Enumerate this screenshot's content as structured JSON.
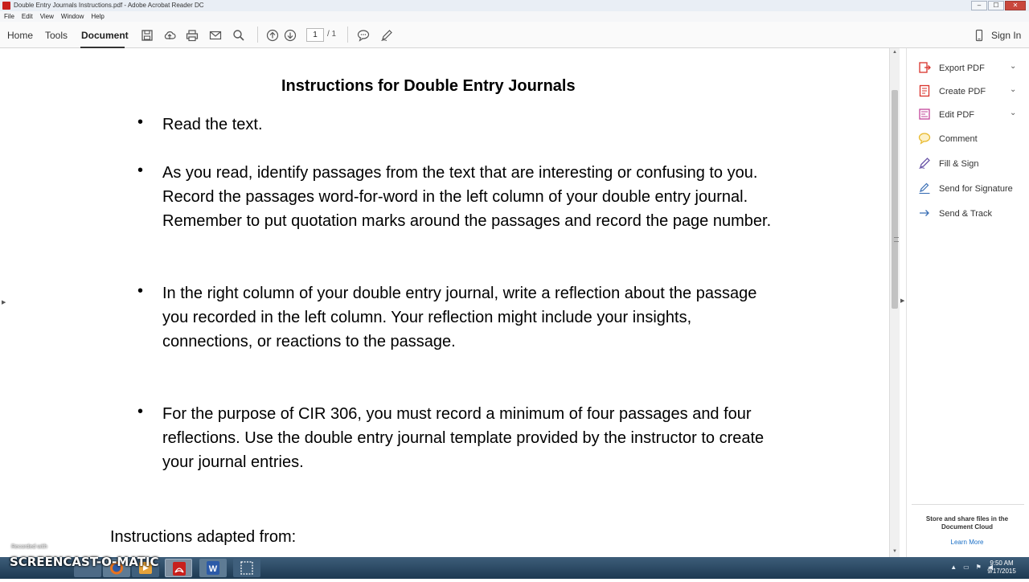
{
  "window": {
    "title": "Double Entry Journals Instructions.pdf - Adobe Acrobat Reader DC",
    "buttons": {
      "minimize": "‒",
      "maximize": "☐",
      "close": "✕"
    }
  },
  "menu": [
    "File",
    "Edit",
    "View",
    "Window",
    "Help"
  ],
  "toolbar": {
    "tabs": [
      {
        "label": "Home"
      },
      {
        "label": "Tools"
      },
      {
        "label": "Document",
        "active": true
      }
    ],
    "icons": [
      "save-icon",
      "upload-cloud-icon",
      "print-icon",
      "email-icon",
      "search-icon",
      "prev-page-icon",
      "next-page-icon",
      "comment-icon",
      "pen-icon"
    ],
    "page_current": "1",
    "page_total": "/ 1",
    "sign_in": "Sign In"
  },
  "document": {
    "title": "Instructions for Double Entry Journals",
    "bullets": [
      "Read the text.",
      "As you read, identify passages from the text that are interesting or confusing to you.  Record the passages word-for-word in the left column of your double entry journal.  Remember to put quotation marks around the passages and record the page number.",
      "In the right column of your double entry journal, write a reflection about the passage you recorded in the left column.  Your reflection might include your insights, connections, or reactions to the passage.",
      "For the purpose of CIR 306, you must record a minimum of four passages and four reflections.  Use the double entry journal template provided by the instructor to create your journal entries."
    ],
    "footer": "Instructions adapted from:"
  },
  "right_pane": {
    "tools": [
      {
        "label": "Export PDF",
        "icon": "export-pdf-icon",
        "color": "#d9322b",
        "expandable": true
      },
      {
        "label": "Create PDF",
        "icon": "create-pdf-icon",
        "color": "#d9322b",
        "expandable": true
      },
      {
        "label": "Edit PDF",
        "icon": "edit-pdf-icon",
        "color": "#c2449a",
        "expandable": true
      },
      {
        "label": "Comment",
        "icon": "comment-icon",
        "color": "#e8b92c",
        "expandable": false
      },
      {
        "label": "Fill & Sign",
        "icon": "fill-sign-icon",
        "color": "#6a55a8",
        "expandable": false
      },
      {
        "label": "Send for Signature",
        "icon": "send-signature-icon",
        "color": "#3a6fb5",
        "expandable": false
      },
      {
        "label": "Send & Track",
        "icon": "send-track-icon",
        "color": "#3a6fb5",
        "expandable": false
      }
    ],
    "promo": "Store and share files in the Document Cloud",
    "learn_more": "Learn More"
  },
  "taskbar": {
    "watermark_small": "Recorded with",
    "watermark_logo": "SCREENCAST-O-MATIC",
    "time": "9:50 AM",
    "date": "9/17/2015"
  }
}
